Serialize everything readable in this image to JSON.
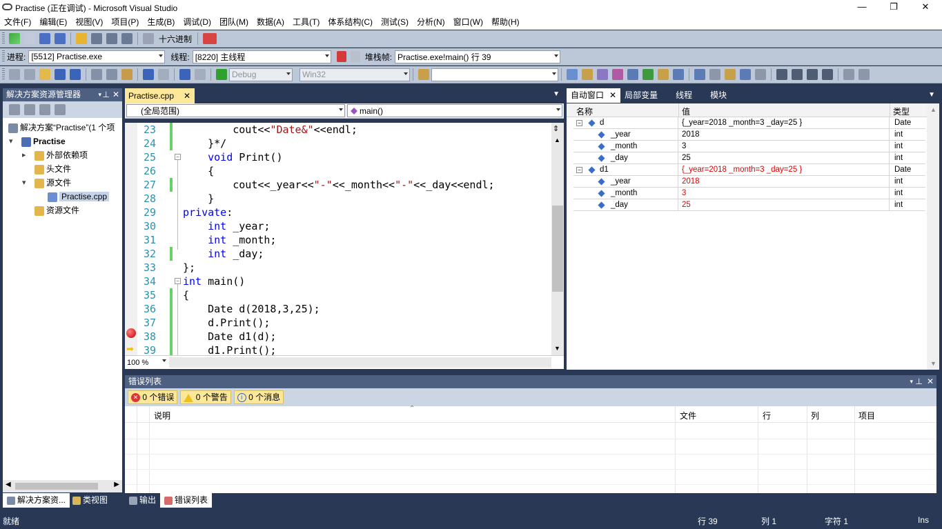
{
  "window": {
    "title": "Practise (正在调试) - Microsoft Visual Studio"
  },
  "menu": [
    "文件(F)",
    "编辑(E)",
    "视图(V)",
    "项目(P)",
    "生成(B)",
    "调试(D)",
    "团队(M)",
    "数据(A)",
    "工具(T)",
    "体系结构(C)",
    "测试(S)",
    "分析(N)",
    "窗口(W)",
    "帮助(H)"
  ],
  "toolbar1": {
    "hex_label": "十六进制"
  },
  "debugbar": {
    "process_label": "进程:",
    "process_value": "[5512] Practise.exe",
    "thread_label": "线程:",
    "thread_value": "[8220] 主线程",
    "stack_label": "堆栈帧:",
    "stack_value": "Practise.exe!main()  行 39"
  },
  "toolbar3": {
    "config": "Debug",
    "platform": "Win32"
  },
  "solution_explorer": {
    "title": "解决方案资源管理器",
    "items": [
      {
        "label": "解决方案“Practise”(1 个项",
        "level": 0
      },
      {
        "label": "Practise",
        "level": 1
      },
      {
        "label": "外部依赖项",
        "level": 2
      },
      {
        "label": "头文件",
        "level": 2
      },
      {
        "label": "源文件",
        "level": 2
      },
      {
        "label": "Practise.cpp",
        "level": 3
      },
      {
        "label": "资源文件",
        "level": 2
      }
    ],
    "bottom_tabs": [
      "解决方案资...",
      "类视图"
    ]
  },
  "editor": {
    "tab": "Practise.cpp",
    "scope": "(全局范围)",
    "function": "main()",
    "zoom": "100 %",
    "lines": [
      {
        "n": "23",
        "segs": [
          [
            "t",
            "        cout<<"
          ],
          [
            "s",
            "\"Date&\""
          ],
          [
            "t",
            "<<endl;"
          ]
        ]
      },
      {
        "n": "24",
        "segs": [
          [
            "t",
            "    }*/"
          ]
        ]
      },
      {
        "n": "25",
        "segs": [
          [
            "k",
            "    void"
          ],
          [
            "t",
            " Print()"
          ]
        ]
      },
      {
        "n": "26",
        "segs": [
          [
            "t",
            "    {"
          ]
        ]
      },
      {
        "n": "27",
        "segs": [
          [
            "t",
            "        cout<<_year<<"
          ],
          [
            "s",
            "\"-\""
          ],
          [
            "t",
            "<<_month<<"
          ],
          [
            "s",
            "\"-\""
          ],
          [
            "t",
            "<<_day<<endl;"
          ]
        ]
      },
      {
        "n": "28",
        "segs": [
          [
            "t",
            "    }"
          ]
        ]
      },
      {
        "n": "29",
        "segs": [
          [
            "k",
            "private"
          ],
          [
            "t",
            ":"
          ]
        ]
      },
      {
        "n": "30",
        "segs": [
          [
            "k",
            "    int"
          ],
          [
            "t",
            " _year;"
          ]
        ]
      },
      {
        "n": "31",
        "segs": [
          [
            "k",
            "    int"
          ],
          [
            "t",
            " _month;"
          ]
        ]
      },
      {
        "n": "32",
        "segs": [
          [
            "k",
            "    int"
          ],
          [
            "t",
            " _day;"
          ]
        ]
      },
      {
        "n": "33",
        "segs": [
          [
            "t",
            "};"
          ]
        ]
      },
      {
        "n": "34",
        "segs": [
          [
            "k",
            "int"
          ],
          [
            "t",
            " main()"
          ]
        ]
      },
      {
        "n": "35",
        "segs": [
          [
            "t",
            "{"
          ]
        ]
      },
      {
        "n": "36",
        "segs": [
          [
            "t",
            "    Date d(2018,3,25);"
          ]
        ]
      },
      {
        "n": "37",
        "segs": [
          [
            "t",
            "    d.Print();"
          ]
        ]
      },
      {
        "n": "38",
        "segs": [
          [
            "t",
            "    Date d1(d);"
          ]
        ]
      },
      {
        "n": "39",
        "segs": [
          [
            "t",
            "    d1.Print();"
          ]
        ]
      }
    ]
  },
  "autos": {
    "tabs": [
      "自动窗口",
      "局部变量",
      "线程",
      "模块"
    ],
    "columns": [
      "名称",
      "值",
      "类型"
    ],
    "rows": [
      {
        "name": "d",
        "value": "{_year=2018 _month=3 _day=25 }",
        "type": "Date",
        "changed": false,
        "level": 0
      },
      {
        "name": "_year",
        "value": "2018",
        "type": "int",
        "changed": false,
        "level": 1
      },
      {
        "name": "_month",
        "value": "3",
        "type": "int",
        "changed": false,
        "level": 1
      },
      {
        "name": "_day",
        "value": "25",
        "type": "int",
        "changed": false,
        "level": 1
      },
      {
        "name": "d1",
        "value": "{_year=2018 _month=3 _day=25 }",
        "type": "Date",
        "changed": true,
        "level": 0
      },
      {
        "name": "_year",
        "value": "2018",
        "type": "int",
        "changed": true,
        "level": 1
      },
      {
        "name": "_month",
        "value": "3",
        "type": "int",
        "changed": true,
        "level": 1
      },
      {
        "name": "_day",
        "value": "25",
        "type": "int",
        "changed": true,
        "level": 1
      }
    ]
  },
  "error_list": {
    "title": "错误列表",
    "filters": [
      "0 个错误",
      "0 个警告",
      "0 个消息"
    ],
    "columns": [
      "说明",
      "文件",
      "行",
      "列",
      "项目"
    ]
  },
  "bottom_tabs": [
    "输出",
    "错误列表"
  ],
  "status": {
    "left": "就绪",
    "line": "行 39",
    "col": "列 1",
    "char": "字符 1",
    "mode": "Ins"
  },
  "colors": {
    "chrome": "#293955",
    "toolbar": "#bcc7d8",
    "changed": "#e00000"
  }
}
